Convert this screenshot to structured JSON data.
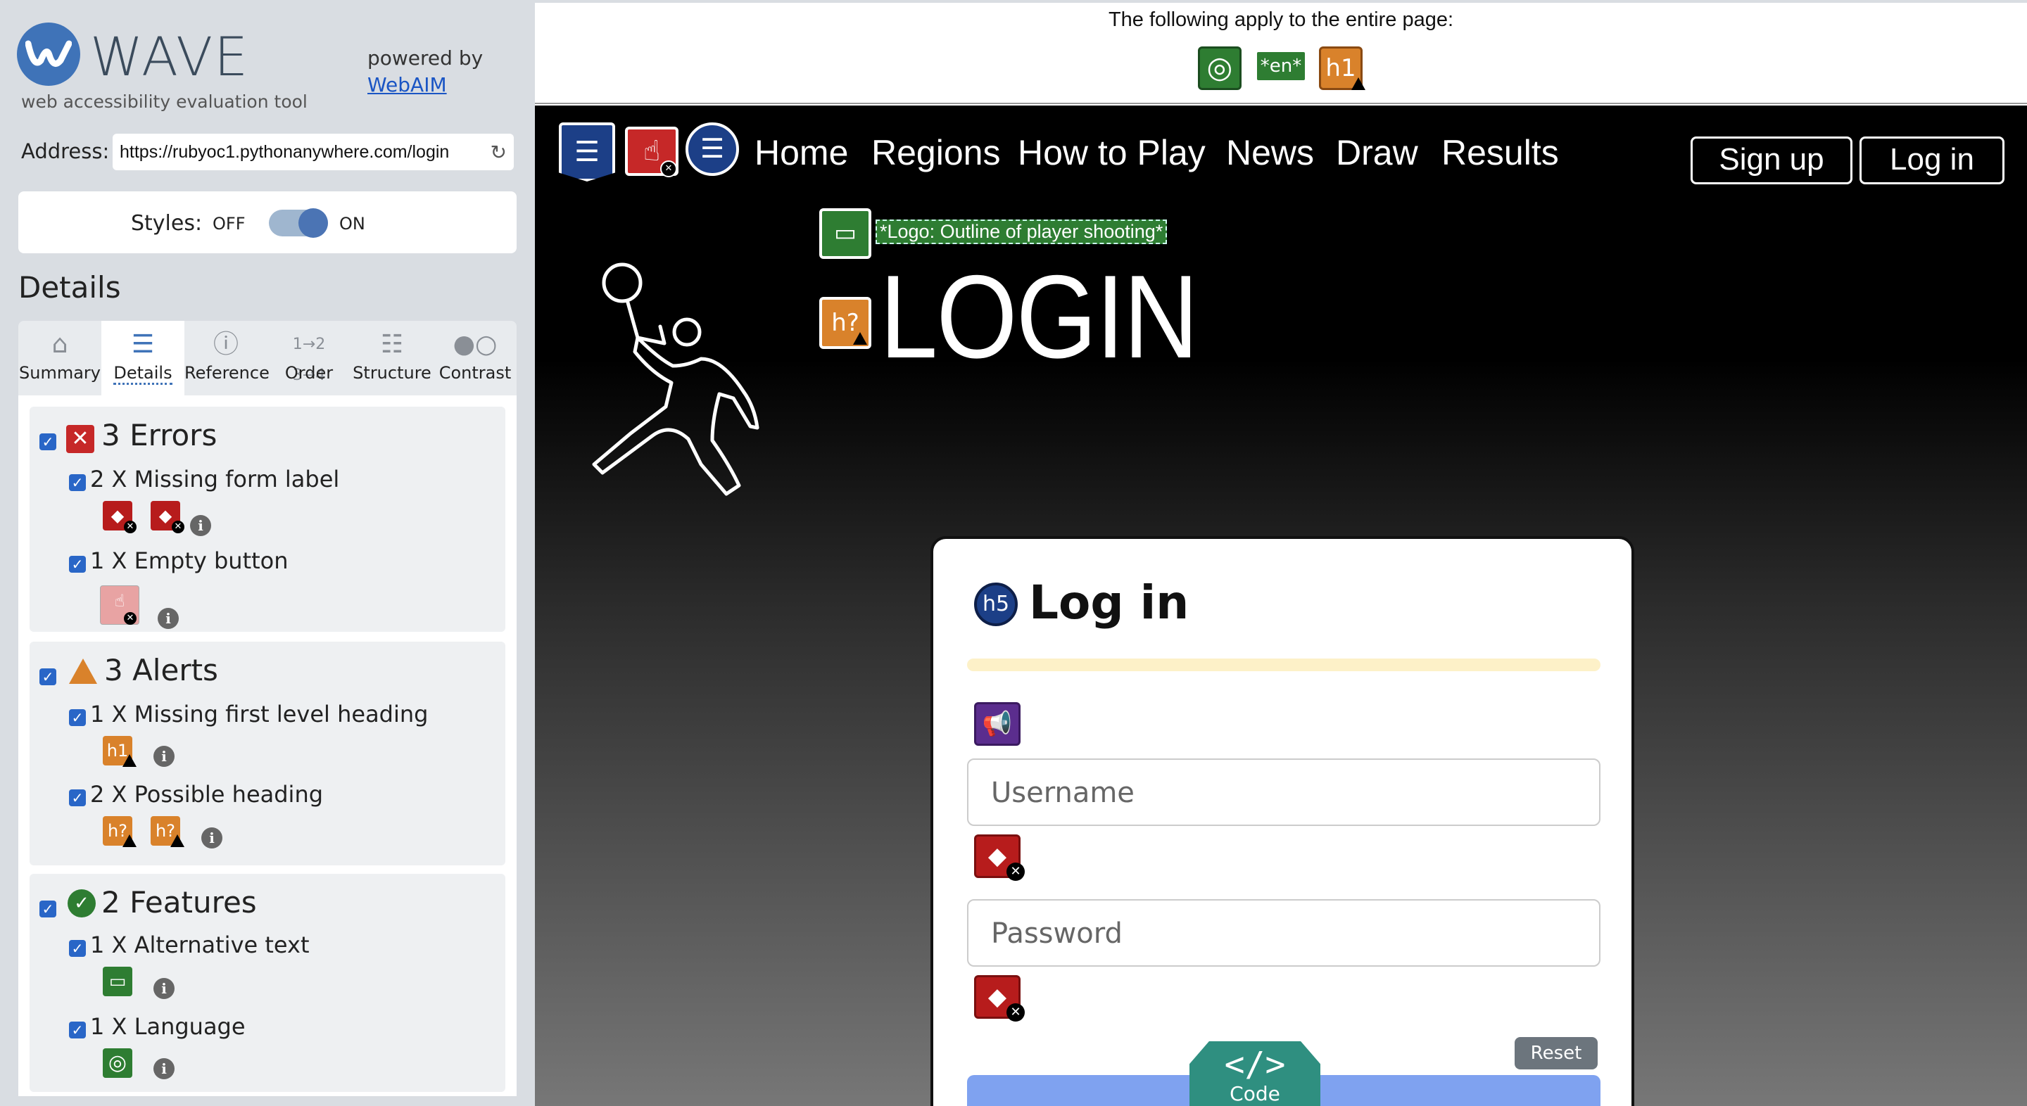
{
  "wave": {
    "title": "WAVE",
    "subtitle": "web accessibility evaluation tool",
    "powered_by": "powered by",
    "webaim_link": "WebAIM",
    "address_label": "Address:",
    "address_value": "https://rubyoc1.pythonanywhere.com/login",
    "styles_label": "Styles:",
    "styles_off": "OFF",
    "styles_on": "ON",
    "styles_state": "on",
    "details_heading": "Details",
    "tabs": [
      {
        "label": "Summary",
        "icon": "home-icon"
      },
      {
        "label": "Details",
        "icon": "list-icon",
        "active": true
      },
      {
        "label": "Reference",
        "icon": "info-icon"
      },
      {
        "label": "Order",
        "icon": "order-icon"
      },
      {
        "label": "Structure",
        "icon": "structure-icon"
      },
      {
        "label": "Contrast",
        "icon": "contrast-icon"
      }
    ],
    "groups": {
      "errors": {
        "title": "3 Errors",
        "items": [
          {
            "label": "2 X Missing form label"
          },
          {
            "label": "1 X Empty button"
          }
        ]
      },
      "alerts": {
        "title": "3 Alerts",
        "items": [
          {
            "label": "1 X Missing first level heading",
            "badge": "h1"
          },
          {
            "label": "2 X Possible heading",
            "badge": "h?"
          }
        ]
      },
      "features": {
        "title": "2 Features",
        "items": [
          {
            "label": "1 X Alternative text"
          },
          {
            "label": "1 X Language"
          }
        ]
      }
    },
    "colors": {
      "accent": "#3f73b8",
      "error": "#c62828",
      "alert": "#d9822b",
      "feature": "#2e7d32"
    }
  },
  "topbar": {
    "message": "The following apply to the entire page:",
    "lang_badge": "*en*",
    "h1_badge": "h1"
  },
  "site": {
    "nav": [
      "Home",
      "Regions",
      "How to Play",
      "News",
      "Draw",
      "Results"
    ],
    "signup": "Sign up",
    "login": "Log in",
    "logo_alt": "*Logo: Outline of player shooting*",
    "heading_badge": "h?",
    "page_heading": "LOGIN",
    "card": {
      "h5_badge": "h5",
      "heading": "Log in",
      "username_placeholder": "Username",
      "password_placeholder": "Password",
      "reset": "Reset"
    },
    "code_tab": {
      "glyph": "</>",
      "label": "Code"
    }
  }
}
